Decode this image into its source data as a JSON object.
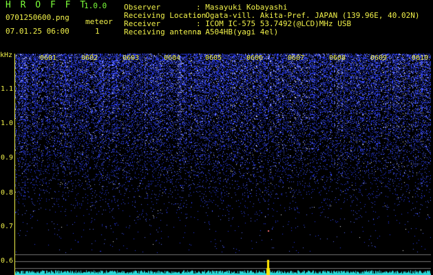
{
  "header": {
    "app_title": "H R O F F T",
    "version": "1.0.0",
    "file_name": "0701250600.png",
    "timestamp": "07.01.25 06:00",
    "meteor_label": "meteor",
    "meteor_count": "1"
  },
  "meta": [
    {
      "key": "Observer",
      "value": ": Masayuki Kobayashi"
    },
    {
      "key": "Receiving Location",
      "value": ": Ogata-vill. Akita-Pref. JAPAN (139.96E, 40.02N)"
    },
    {
      "key": "Receiver",
      "value": ": ICOM IC-575 53.7492(@LCD)MHz USB"
    },
    {
      "key": "Receiving antenna",
      "value": ": A504HB(yagi 4el)"
    }
  ],
  "plot": {
    "y_unit": "kHz",
    "y_ticks": [
      "1.1",
      "1.0",
      "0.9",
      "0.8",
      "0.7",
      "0.6"
    ],
    "x_ticks": [
      "0601",
      "0602",
      "0603",
      "0604",
      "0605",
      "0606",
      "0607",
      "0608",
      "0609",
      "0610"
    ],
    "colors": {
      "noise": "#2a3cff",
      "spark": "#ffffff",
      "axis": "#f2f24a",
      "trace": "#2bd9d9",
      "peak": "#ffe600"
    }
  }
}
